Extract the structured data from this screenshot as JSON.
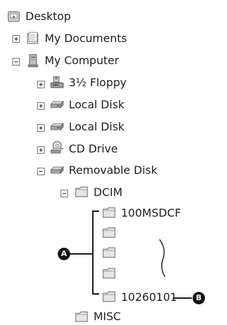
{
  "tree": {
    "desktop": {
      "label": "Desktop",
      "icon": "desktop-icon"
    },
    "my_documents": {
      "label": "My Documents",
      "icon": "documents-folder-icon",
      "expander": "plus"
    },
    "my_computer": {
      "label": "My Computer",
      "icon": "computer-icon",
      "expander": "minus"
    },
    "floppy": {
      "label": "3½ Floppy",
      "icon": "floppy-drive-icon",
      "expander": "plus"
    },
    "local_disk_1": {
      "label": "Local Disk",
      "icon": "hard-disk-icon",
      "expander": "plus"
    },
    "local_disk_2": {
      "label": "Local Disk",
      "icon": "hard-disk-icon",
      "expander": "plus"
    },
    "cd_drive": {
      "label": "CD Drive",
      "icon": "cd-drive-icon",
      "expander": "plus"
    },
    "removable_disk": {
      "label": "Removable Disk",
      "icon": "removable-disk-icon",
      "expander": "minus"
    },
    "dcim": {
      "label": "DCIM",
      "icon": "folder-icon",
      "expander": "minus"
    },
    "folder_first": {
      "label": "100MSDCF",
      "icon": "folder-icon"
    },
    "folder_last": {
      "label": "10260101",
      "icon": "folder-icon"
    },
    "misc": {
      "label": "MISC",
      "icon": "folder-icon"
    }
  },
  "callouts": {
    "a": "A",
    "b": "B"
  },
  "colors": {
    "folder_fill": "#e6e6e6",
    "folder_stroke": "#666666",
    "callout": "#111111"
  }
}
